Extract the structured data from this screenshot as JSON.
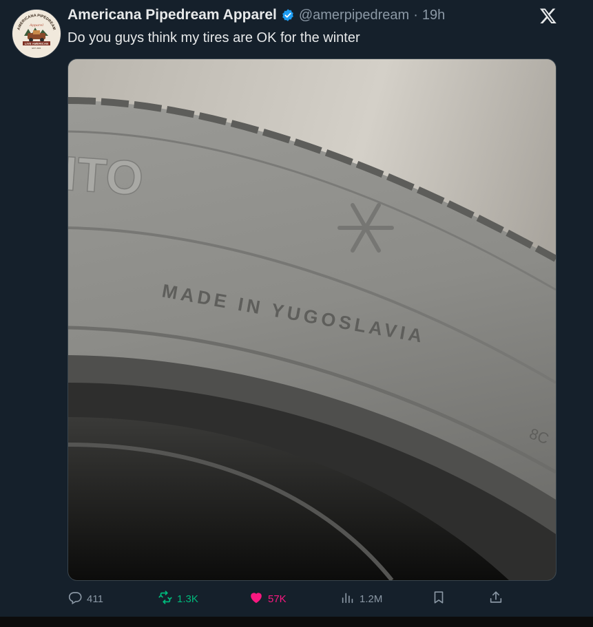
{
  "tweet": {
    "author_name": "Americana Pipedream Apparel",
    "handle": "@amerpipedream",
    "separator": "·",
    "time": "19h",
    "text": "Do you guys think my tires are OK for the winter"
  },
  "avatar": {
    "top_text": "AMERICANA PIPEDREAM",
    "script_text": "Apparel",
    "banner_text": "LIVE AMERICAN",
    "est_text": "EST. 2021"
  },
  "image": {
    "tire_text": "MADE IN YUGOSLAVIA",
    "brand_fragment": "ITO",
    "size_fragment": "8C"
  },
  "actions": {
    "replies": "411",
    "reposts": "1.3K",
    "likes": "57K",
    "views": "1.2M"
  },
  "colors": {
    "background": "#15202b",
    "verified": "#1d9bf0",
    "repost": "#00ba7c",
    "like": "#f91880",
    "muted": "#8b98a5"
  },
  "icons": [
    "verified-badge-icon",
    "x-logo-icon",
    "reply-icon",
    "repost-icon",
    "heart-icon",
    "views-icon",
    "bookmark-icon",
    "share-icon"
  ]
}
